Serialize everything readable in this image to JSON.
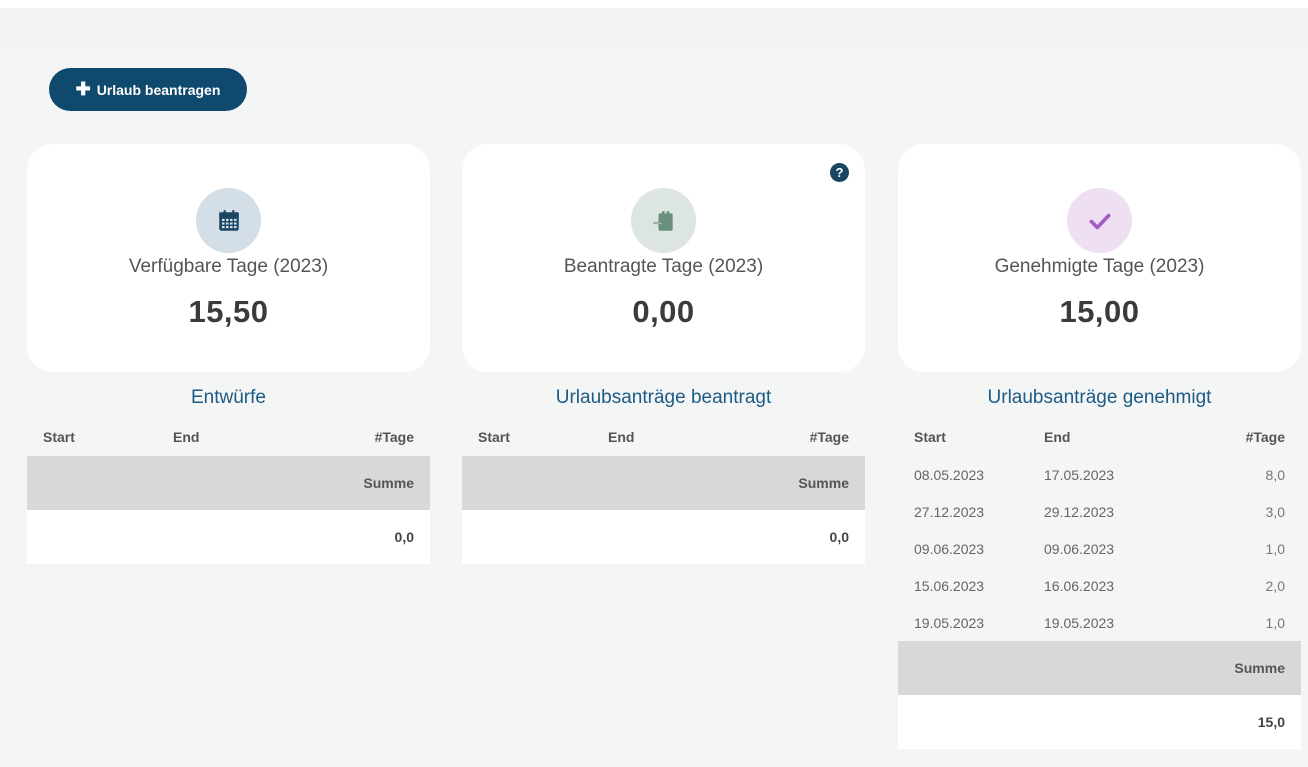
{
  "toolbar": {
    "new_request_label": "Urlaub beantragen"
  },
  "cards": [
    {
      "label": "Verfügbare Tage (2023)",
      "value": "15,50",
      "icon": "calendar-icon",
      "icon_bg": "#d3dee7",
      "icon_color": "#1a4663"
    },
    {
      "label": "Beantragte Tage (2023)",
      "value": "0,00",
      "icon": "clipboard-arrow-icon",
      "icon_bg": "#dde5e1",
      "icon_color": "#6b8f7e",
      "help": "?"
    },
    {
      "label": "Genehmigte Tage (2023)",
      "value": "15,00",
      "icon": "check-icon",
      "icon_bg": "#efdff3",
      "icon_color": "#a45fc4"
    }
  ],
  "tables": [
    {
      "title": "Entwürfe",
      "headers": {
        "start": "Start",
        "end": "End",
        "days": "#Tage"
      },
      "rows": [],
      "sum_label": "Summe",
      "sum_value": "0,0"
    },
    {
      "title": "Urlaubsanträge beantragt",
      "headers": {
        "start": "Start",
        "end": "End",
        "days": "#Tage"
      },
      "rows": [],
      "sum_label": "Summe",
      "sum_value": "0,0"
    },
    {
      "title": "Urlaubsanträge genehmigt",
      "headers": {
        "start": "Start",
        "end": "End",
        "days": "#Tage"
      },
      "rows": [
        {
          "start": "08.05.2023",
          "end": "17.05.2023",
          "days": "8,0"
        },
        {
          "start": "27.12.2023",
          "end": "29.12.2023",
          "days": "3,0"
        },
        {
          "start": "09.06.2023",
          "end": "09.06.2023",
          "days": "1,0"
        },
        {
          "start": "15.06.2023",
          "end": "16.06.2023",
          "days": "2,0"
        },
        {
          "start": "19.05.2023",
          "end": "19.05.2023",
          "days": "1,0"
        }
      ],
      "sum_label": "Summe",
      "sum_value": "15,0"
    }
  ]
}
